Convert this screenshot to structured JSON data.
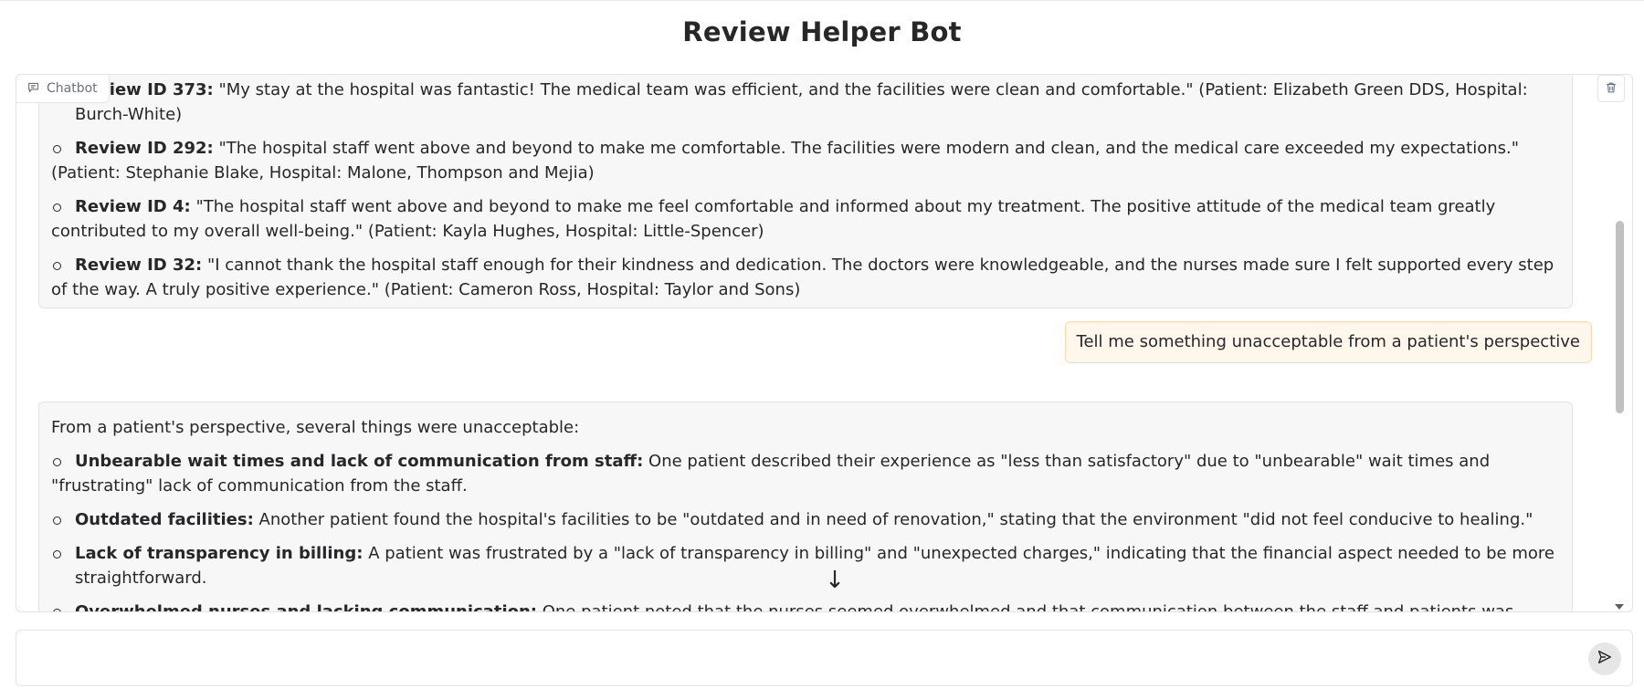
{
  "app": {
    "title": "Review Helper Bot"
  },
  "chatbot": {
    "label": "Chatbot",
    "messages": [
      {
        "role": "bot",
        "items": [
          {
            "title": "Review ID 373:",
            "text": "\"My stay at the hospital was fantastic! The medical team was efficient, and the facilities were clean and comfortable.\" (Patient: Elizabeth Green DDS, Hospital: Burch-White)"
          },
          {
            "title": "Review ID 292:",
            "text": "\"The hospital staff went above and beyond to make me comfortable. The facilities were modern and clean, and the medical care exceeded my expectations.\" (Patient: Stephanie Blake, Hospital: Malone, Thompson and Mejia)"
          },
          {
            "title": "Review ID 4:",
            "text": "\"The hospital staff went above and beyond to make me feel comfortable and informed about my treatment. The positive attitude of the medical team greatly contributed to my overall well-being.\" (Patient: Kayla Hughes, Hospital: Little-Spencer)"
          },
          {
            "title": "Review ID 32:",
            "text": "\"I cannot thank the hospital staff enough for their kindness and dedication. The doctors were knowledgeable, and the nurses made sure I felt supported every step of the way. A truly positive experience.\" (Patient: Cameron Ross, Hospital: Taylor and Sons)"
          }
        ]
      },
      {
        "role": "user",
        "text": "Tell me something unacceptable from a patient's perspective"
      },
      {
        "role": "bot",
        "intro": "From a patient's perspective, several things were unacceptable:",
        "items": [
          {
            "title": "Unbearable wait times and lack of communication from staff:",
            "text": "One patient described their experience as \"less than satisfactory\" due to \"unbearable\" wait times and \"frustrating\" lack of communication from the staff."
          },
          {
            "title": "Outdated facilities:",
            "text": "Another patient found the hospital's facilities to be \"outdated and in need of renovation,\" stating that the environment \"did not feel conducive to healing.\""
          },
          {
            "title": "Lack of transparency in billing:",
            "text": "A patient was frustrated by a \"lack of transparency in billing\" and \"unexpected charges,\" indicating that the financial aspect needed to be more straightforward."
          },
          {
            "title": "Overwhelmed nurses and lacking communication:",
            "text": "One patient noted that the nurses seemed overwhelmed and that communication between the staff and patients was lacking."
          }
        ]
      }
    ]
  },
  "input": {
    "placeholder": "",
    "value": ""
  },
  "icons": {
    "chat": "chat-bubble-icon",
    "clear": "trash-icon",
    "send": "send-icon",
    "jump": "arrow-down-icon"
  },
  "colors": {
    "user_bubble_bg": "#fff6ec",
    "user_bubble_border": "#fcd8b0",
    "bot_bubble_bg": "#f7f7f7"
  }
}
